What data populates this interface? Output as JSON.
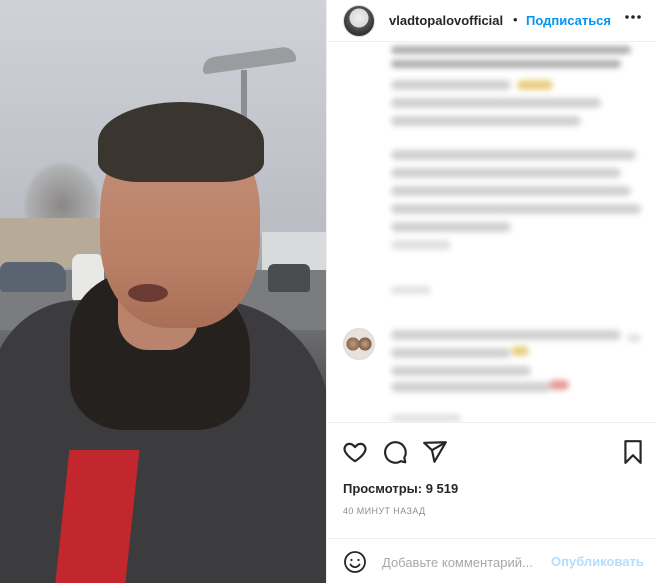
{
  "post": {
    "username": "vladtopalovofficial",
    "separator": "•",
    "follow_label": "Подписаться",
    "more_label": "•••"
  },
  "stats": {
    "views_label": "Просмотры: 9 519",
    "time_label": "40 МИНУТ НАЗАД"
  },
  "comment_box": {
    "placeholder": "Добавьте комментарий...",
    "publish_label": "Опубликовать"
  },
  "icons": {
    "like": "heart-icon",
    "comment": "comment-icon",
    "share": "share-icon",
    "save": "bookmark-icon",
    "emoji": "emoji-icon",
    "more": "more-options-icon"
  },
  "colors": {
    "link_blue": "#0095f6",
    "publish_disabled": "#b2dffc",
    "text": "#262626",
    "muted": "#8e8e8e"
  }
}
